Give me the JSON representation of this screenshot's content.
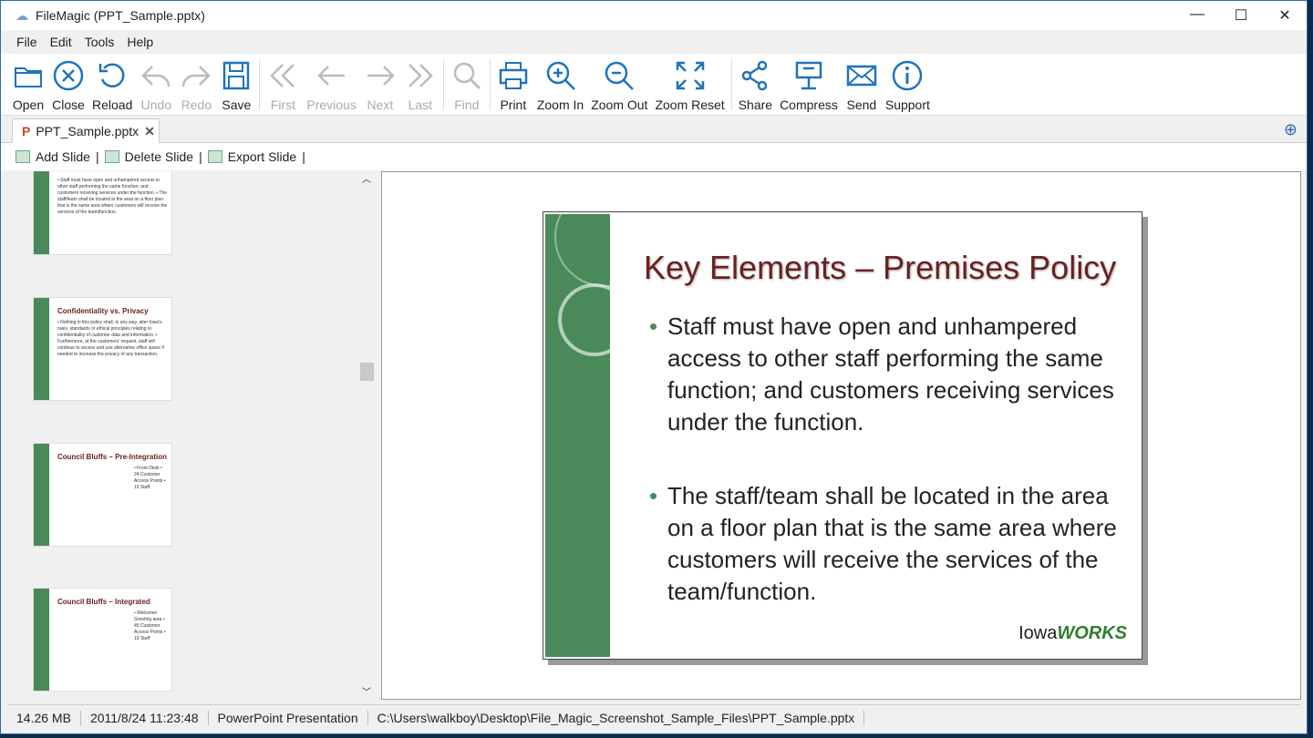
{
  "window": {
    "title": "FileMagic (PPT_Sample.pptx)",
    "min": "—",
    "max": "☐",
    "close": "✕"
  },
  "menu": [
    "File",
    "Edit",
    "Tools",
    "Help"
  ],
  "toolbar": [
    {
      "label": "Open",
      "icon": "folder-icon",
      "enabled": true
    },
    {
      "label": "Close",
      "icon": "close-circle-icon",
      "enabled": true
    },
    {
      "label": "Reload",
      "icon": "reload-icon",
      "enabled": true
    },
    {
      "label": "Undo",
      "icon": "undo-icon",
      "enabled": false
    },
    {
      "label": "Redo",
      "icon": "redo-icon",
      "enabled": false
    },
    {
      "label": "Save",
      "icon": "save-icon",
      "enabled": true
    },
    {
      "label": "First",
      "icon": "first-icon",
      "enabled": false
    },
    {
      "label": "Previous",
      "icon": "previous-icon",
      "enabled": false
    },
    {
      "label": "Next",
      "icon": "next-icon",
      "enabled": false
    },
    {
      "label": "Last",
      "icon": "last-icon",
      "enabled": false
    },
    {
      "label": "Find",
      "icon": "search-icon",
      "enabled": false
    },
    {
      "label": "Print",
      "icon": "print-icon",
      "enabled": true
    },
    {
      "label": "Zoom In",
      "icon": "zoom-in-icon",
      "enabled": true
    },
    {
      "label": "Zoom Out",
      "icon": "zoom-out-icon",
      "enabled": true
    },
    {
      "label": "Zoom Reset",
      "icon": "zoom-reset-icon",
      "enabled": true
    },
    {
      "label": "Share",
      "icon": "share-icon",
      "enabled": true
    },
    {
      "label": "Compress",
      "icon": "compress-icon",
      "enabled": true
    },
    {
      "label": "Send",
      "icon": "mail-icon",
      "enabled": true
    },
    {
      "label": "Support",
      "icon": "info-icon",
      "enabled": true
    }
  ],
  "tab": {
    "label": "PPT_Sample.pptx",
    "close": "✕"
  },
  "slide_toolbar": {
    "add": "Add Slide",
    "delete": "Delete Slide",
    "export": "Export Slide",
    "sep": "|"
  },
  "thumbnails": [
    {
      "title": "",
      "text": "• Staff must have open and unhampered access to other staff performing the same function; and customers receiving services under the function. • The staff/team shall be located in the area on a floor plan that is the same area where customers will receive the services of the team/function."
    },
    {
      "title": "Confidentiality vs. Privacy",
      "text": "• Nothing in this policy shall, in any way, alter Iowa's rules, standards or ethical principles relating to confidentiality of customer data and information. • Furthermore, at the customers' request, staff will continue to access and use alternative office space if needed to increase the privacy of any transaction."
    },
    {
      "title": "Council Bluffs – Pre-Integration",
      "text": "• Front Desk • 24 Customer Access Points • 19 Staff"
    },
    {
      "title": "Council Bluffs – Integrated",
      "text": "• Welcome/ Greeting area • 45 Customer Access Points • 19 Staff"
    }
  ],
  "slide": {
    "title": "Key Elements – Premises Policy",
    "bullets": [
      "Staff must have open and unhampered access to other staff performing the same function; and customers receiving services under the function.",
      "The staff/team shall be located in the area on a floor plan that is the same area where customers will receive the services of the team/function."
    ],
    "logo": "IowaWORKS"
  },
  "status": {
    "size": "14.26 MB",
    "date": "2011/8/24 11:23:48",
    "type": "PowerPoint Presentation",
    "path": "C:\\Users\\walkboy\\Desktop\\File_Magic_Screenshot_Sample_Files\\PPT_Sample.pptx"
  },
  "colors": {
    "accent": "#2b6cb0",
    "slide_green": "#4a8a5a",
    "slide_title": "#6b2020"
  }
}
